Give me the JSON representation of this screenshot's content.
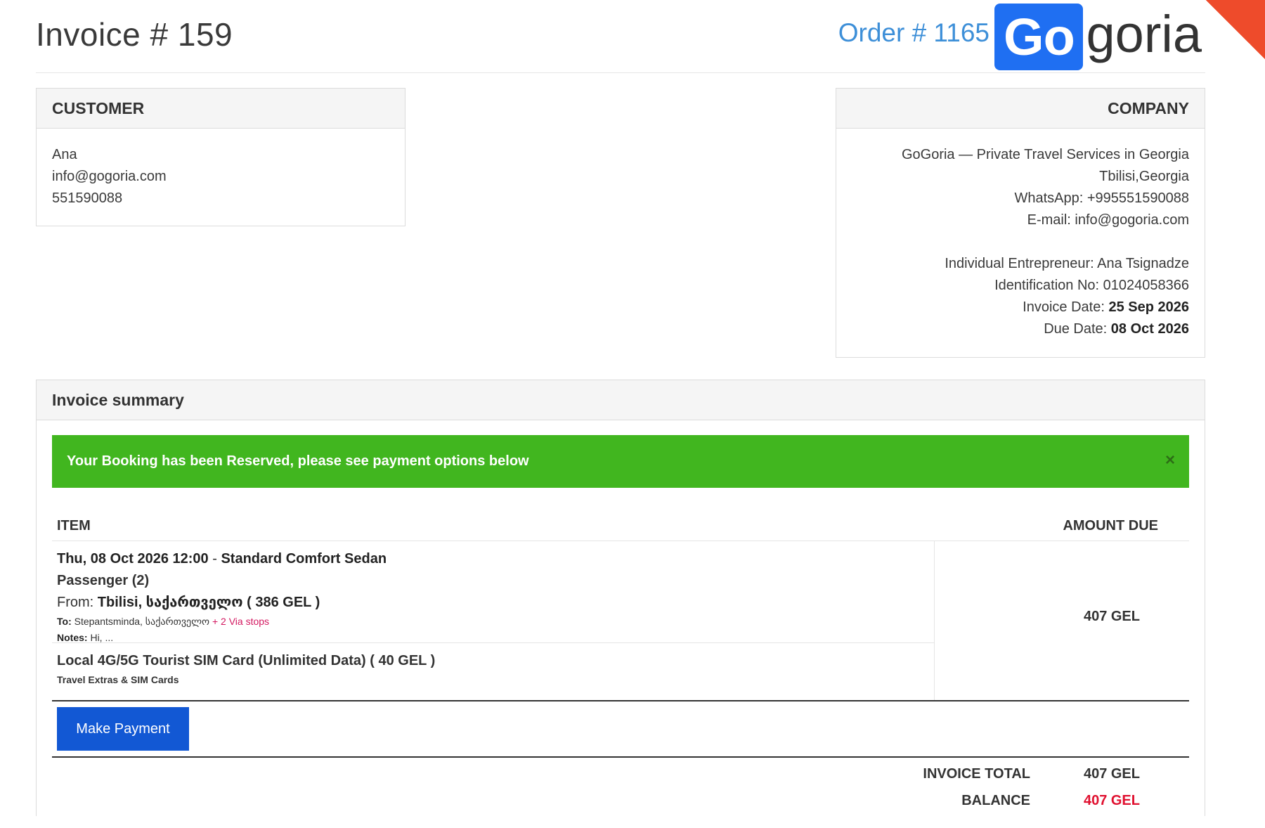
{
  "header": {
    "invoice_title": "Invoice # 159",
    "order_number": "Order # 1165",
    "logo_highlight": "Go",
    "logo_rest": "goria"
  },
  "customer": {
    "heading": "CUSTOMER",
    "name": "Ana",
    "email": "info@gogoria.com",
    "phone": "551590088"
  },
  "company": {
    "heading": "COMPANY",
    "name": "GoGoria — Private Travel Services in Georgia",
    "city": "Tbilisi,Georgia",
    "whatsapp": "WhatsApp: +995551590088",
    "email": "E-mail: info@gogoria.com",
    "entrepreneur": "Individual Entrepreneur: Ana Tsignadze",
    "identification": "Identification No: 01024058366",
    "invoice_date_label": "Invoice Date: ",
    "invoice_date": "25 Sep 2026",
    "due_date_label": "Due Date: ",
    "due_date": "08 Oct 2026"
  },
  "summary": {
    "heading": "Invoice summary",
    "alert_text": "Your Booking has been Reserved, please see payment options below",
    "alert_close": "×",
    "col_item": "ITEM",
    "col_amount": "AMOUNT DUE",
    "booking": {
      "datetime": "Thu, 08 Oct 2026 12:00",
      "separator": " - ",
      "vehicle": "Standard Comfort Sedan",
      "passengers": "Passenger (2)",
      "from_label": "From: ",
      "from_value": "Tbilisi, საქართველო ( 386 GEL )",
      "to_label": "To:",
      "to_value": " Stepantsminda, საქართველო ",
      "via_stops": "+ 2 Via stops",
      "notes_label": "Notes:",
      "notes_value": " Hi, ..."
    },
    "extra": {
      "title": "Local 4G/5G Tourist SIM Card (Unlimited Data) ( 40 GEL )",
      "category": "Travel Extras & SIM Cards"
    },
    "amount_due": "407 GEL",
    "pay_button": "Make Payment",
    "invoice_total_label": "INVOICE TOTAL",
    "invoice_total": "407 GEL",
    "balance_label": "BALANCE",
    "balance": "407 GEL"
  },
  "colors": {
    "accent_blue": "#1f6ff2",
    "order_blue": "#3d8fd8",
    "success_green": "#41b61f",
    "button_blue": "#1258d4",
    "balance_red": "#e0102f",
    "via_pink": "#d31860"
  },
  "icons": {
    "alert_close": "close-icon"
  }
}
